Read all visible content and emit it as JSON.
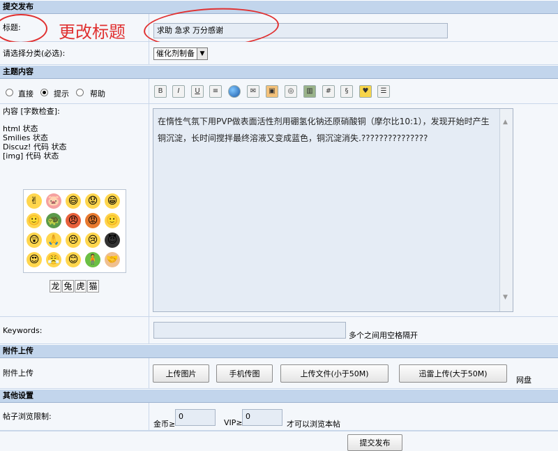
{
  "sections": {
    "submit_header": "提交发布",
    "content_header": "主题内容",
    "attachment_header": "附件上传",
    "other_header": "其他设置"
  },
  "title_row": {
    "label": "标题:",
    "value": "求助 急求 万分感谢",
    "annotation": "更改标题"
  },
  "category_row": {
    "label": "请选择分类(必选):",
    "selected": "催化剂制备"
  },
  "mode_row": {
    "options": [
      "直接",
      "提示",
      "帮助"
    ],
    "selected": "提示"
  },
  "editor_toolbar": {
    "icons": [
      "bold-icon",
      "italic-icon",
      "underline-icon",
      "font-color-icon",
      "globe-link-icon",
      "email-icon",
      "image-icon",
      "media-icon",
      "film-icon",
      "code-icon",
      "quote-icon",
      "heart-icon",
      "list-icon"
    ]
  },
  "content_row": {
    "label": "内容 [字数检查]:",
    "status_lines": [
      "html 状态",
      "Smilies 状态",
      "Discuz! 代码  状态",
      "[img] 代码  状态"
    ],
    "body": "在惰性气氛下用PVP做表面活性剂用硼氢化钠还原硝酸铜（摩尔比10:1），发现开始时产生铜沉淀，长时间搅拌最终溶液又变成蓝色，铜沉淀消失.???????????????"
  },
  "smilies": [
    "✌",
    "🐷",
    "😄",
    "😟",
    "😁",
    "🙂",
    "🐢",
    "😠",
    "😡",
    "🙂",
    "😲",
    "🙏",
    "😣",
    "😢",
    "😈",
    "😍",
    "😤",
    "😊",
    "🧍",
    "🤝"
  ],
  "zodiac_tabs": [
    "龙",
    "兔",
    "虎",
    "猫"
  ],
  "keywords_row": {
    "label": "Keywords:",
    "value": "",
    "hint": "多个之间用空格隔开"
  },
  "attachment_row": {
    "label": "附件上传",
    "buttons": [
      "上传图片",
      "手机传图",
      "上传文件(小于50M)",
      "迅雷上传(大于50M)"
    ],
    "trailing": "网盘"
  },
  "other_row": {
    "label": "帖子浏览限制:",
    "gold_label": "金币≥",
    "gold_value": "0",
    "vip_label": "VIP≥",
    "vip_value": "0",
    "suffix": "才可以浏览本帖"
  },
  "submit_button": "提交发布"
}
